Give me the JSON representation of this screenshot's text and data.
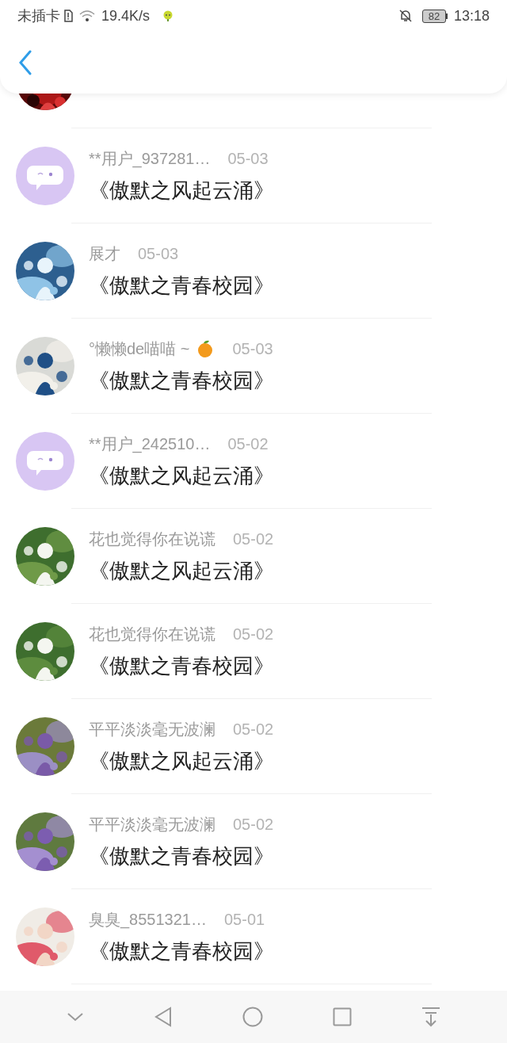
{
  "status_bar": {
    "carrier": "未插卡",
    "speed": "19.4K/s",
    "battery": "82",
    "time": "13:18"
  },
  "rows": [
    {
      "kind": "default",
      "name": "**用户_937281…",
      "date": "05-03",
      "title": "《傲默之风起云涌》"
    },
    {
      "kind": "picture",
      "name": "展才",
      "date": "05-03",
      "title": "《傲默之青春校园》"
    },
    {
      "kind": "picture",
      "name": "°懒懒de喵喵 ~",
      "trailing_icon": true,
      "date": "05-03",
      "title": "《傲默之青春校园》"
    },
    {
      "kind": "default",
      "name": "**用户_242510…",
      "date": "05-02",
      "title": "《傲默之风起云涌》"
    },
    {
      "kind": "picture",
      "name": "花也觉得你在说谎",
      "date": "05-02",
      "title": "《傲默之风起云涌》"
    },
    {
      "kind": "picture",
      "name": "花也觉得你在说谎",
      "date": "05-02",
      "title": "《傲默之青春校园》"
    },
    {
      "kind": "picture",
      "name": "平平淡淡毫无波澜",
      "date": "05-02",
      "title": "《傲默之风起云涌》"
    },
    {
      "kind": "picture",
      "name": "平平淡淡毫无波澜",
      "date": "05-02",
      "title": "《傲默之青春校园》"
    },
    {
      "kind": "picture",
      "name": "臭臭_8551321…",
      "date": "05-01",
      "title": "《傲默之青春校园》"
    }
  ]
}
